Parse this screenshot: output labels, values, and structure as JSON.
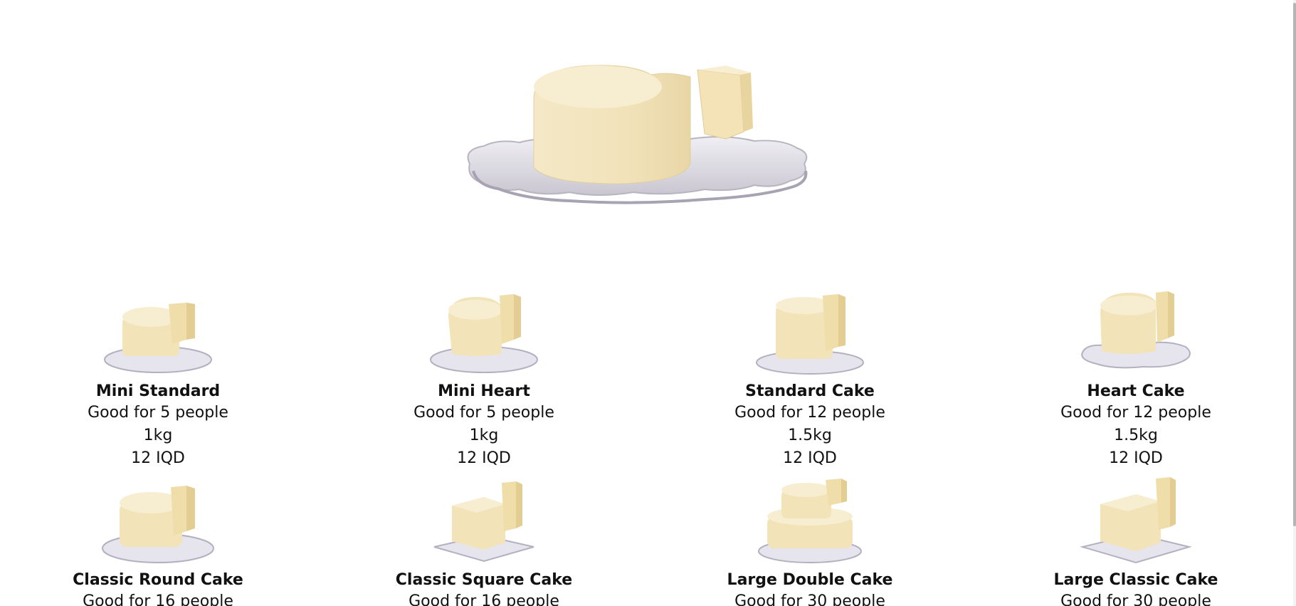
{
  "hero": {
    "image": "heart-cake-hero",
    "colors": {
      "cake": "#f3e6c2",
      "plate": "#e4e2ea"
    }
  },
  "products": [
    {
      "name": "Mini Standard",
      "serves": "Good for 5 people",
      "weight": "1kg",
      "price": "12 IQD",
      "image": "round-cake-slice"
    },
    {
      "name": "Mini Heart",
      "serves": "Good for 5 people",
      "weight": "1kg",
      "price": "12 IQD",
      "image": "heart-cake-slice"
    },
    {
      "name": "Standard Cake",
      "serves": "Good for 12 people",
      "weight": "1.5kg",
      "price": "12 IQD",
      "image": "tall-round-cake-slice"
    },
    {
      "name": "Heart Cake",
      "serves": "Good for 12 people",
      "weight": "1.5kg",
      "price": "12 IQD",
      "image": "heart-cake-wavy-plate"
    },
    {
      "name": "Classic Round Cake",
      "serves": "Good for 16 people",
      "weight": "",
      "price": "",
      "image": "round-cake-slice"
    },
    {
      "name": "Classic Square Cake",
      "serves": "Good for 16 people",
      "weight": "",
      "price": "",
      "image": "square-cake-slice"
    },
    {
      "name": "Large Double Cake",
      "serves": "Good for 30 people",
      "weight": "",
      "price": "",
      "image": "double-tier-cake"
    },
    {
      "name": "Large Classic Cake",
      "serves": "Good for 30 people",
      "weight": "",
      "price": "",
      "image": "large-square-cake"
    }
  ]
}
